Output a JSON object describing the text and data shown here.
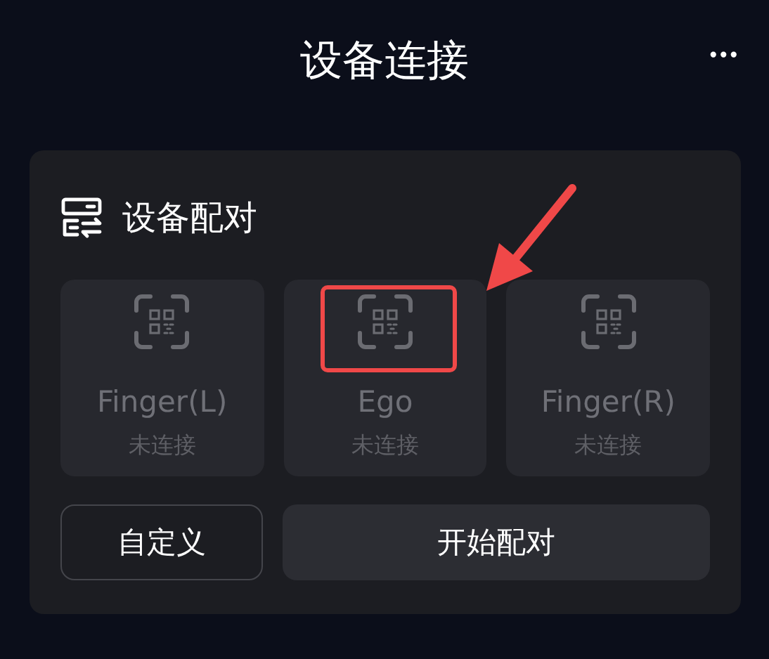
{
  "header": {
    "title": "设备连接",
    "menu": "•••"
  },
  "pairing": {
    "title": "设备配对",
    "devices": [
      {
        "name": "Finger(L)",
        "status": "未连接",
        "highlighted": false
      },
      {
        "name": "Ego",
        "status": "未连接",
        "highlighted": true
      },
      {
        "name": "Finger(R)",
        "status": "未连接",
        "highlighted": false
      }
    ],
    "buttons": [
      {
        "label": "自定义",
        "kind": "outline"
      },
      {
        "label": "开始配对",
        "kind": "filled"
      }
    ]
  }
}
